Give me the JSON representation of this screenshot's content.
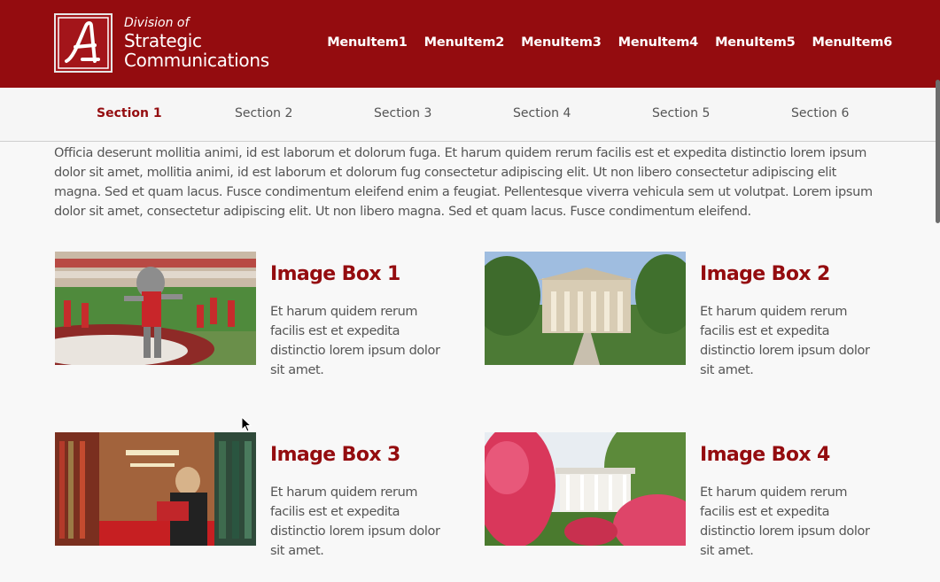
{
  "header": {
    "brand_small": "Division of",
    "brand_line1": "Strategic",
    "brand_line2": "Communications",
    "logo_letter": "A",
    "menu": [
      "MenuItem1",
      "MenuItem2",
      "MenuItem3",
      "MenuItem4",
      "MenuItem5",
      "MenuItem6"
    ],
    "color": "#940c0f"
  },
  "subnav": {
    "active": "Section 1",
    "sections": [
      "Section 1",
      "Section 2",
      "Section 3",
      "Section 4",
      "Section 5",
      "Section 6"
    ]
  },
  "intro": "Officia deserunt mollitia animi, id est laborum et dolorum fuga. Et harum quidem rerum facilis est et expedita distinctio lorem ipsum dolor sit amet, mollitia animi, id est laborum et dolorum fug consectetur adipiscing elit. Ut non libero consectetur adipiscing elit magna. Sed et quam lacus. Fusce condimentum eleifend enim a feugiat. Pellentesque viverra vehicula sem ut volutpat. Lorem ipsum dolor sit amet, consectetur adipiscing elit. Ut non libero magna. Sed et quam lacus. Fusce condimentum eleifend.",
  "cards": [
    {
      "title": "Image Box 1",
      "text": "Et harum quidem rerum facilis est et expedita distinctio lorem ipsum dolor sit amet.",
      "image": "mascot-photo"
    },
    {
      "title": "Image Box 2",
      "text": "Et harum quidem rerum facilis est et expedita distinctio lorem ipsum dolor sit amet.",
      "image": "building-photo"
    },
    {
      "title": "Image Box 3",
      "text": "Et harum quidem rerum facilis est et expedita distinctio lorem ipsum dolor sit amet.",
      "image": "library-photo"
    },
    {
      "title": "Image Box 4",
      "text": "Et harum quidem rerum facilis est et expedita distinctio lorem ipsum dolor sit amet.",
      "image": "mansion-photo"
    }
  ]
}
